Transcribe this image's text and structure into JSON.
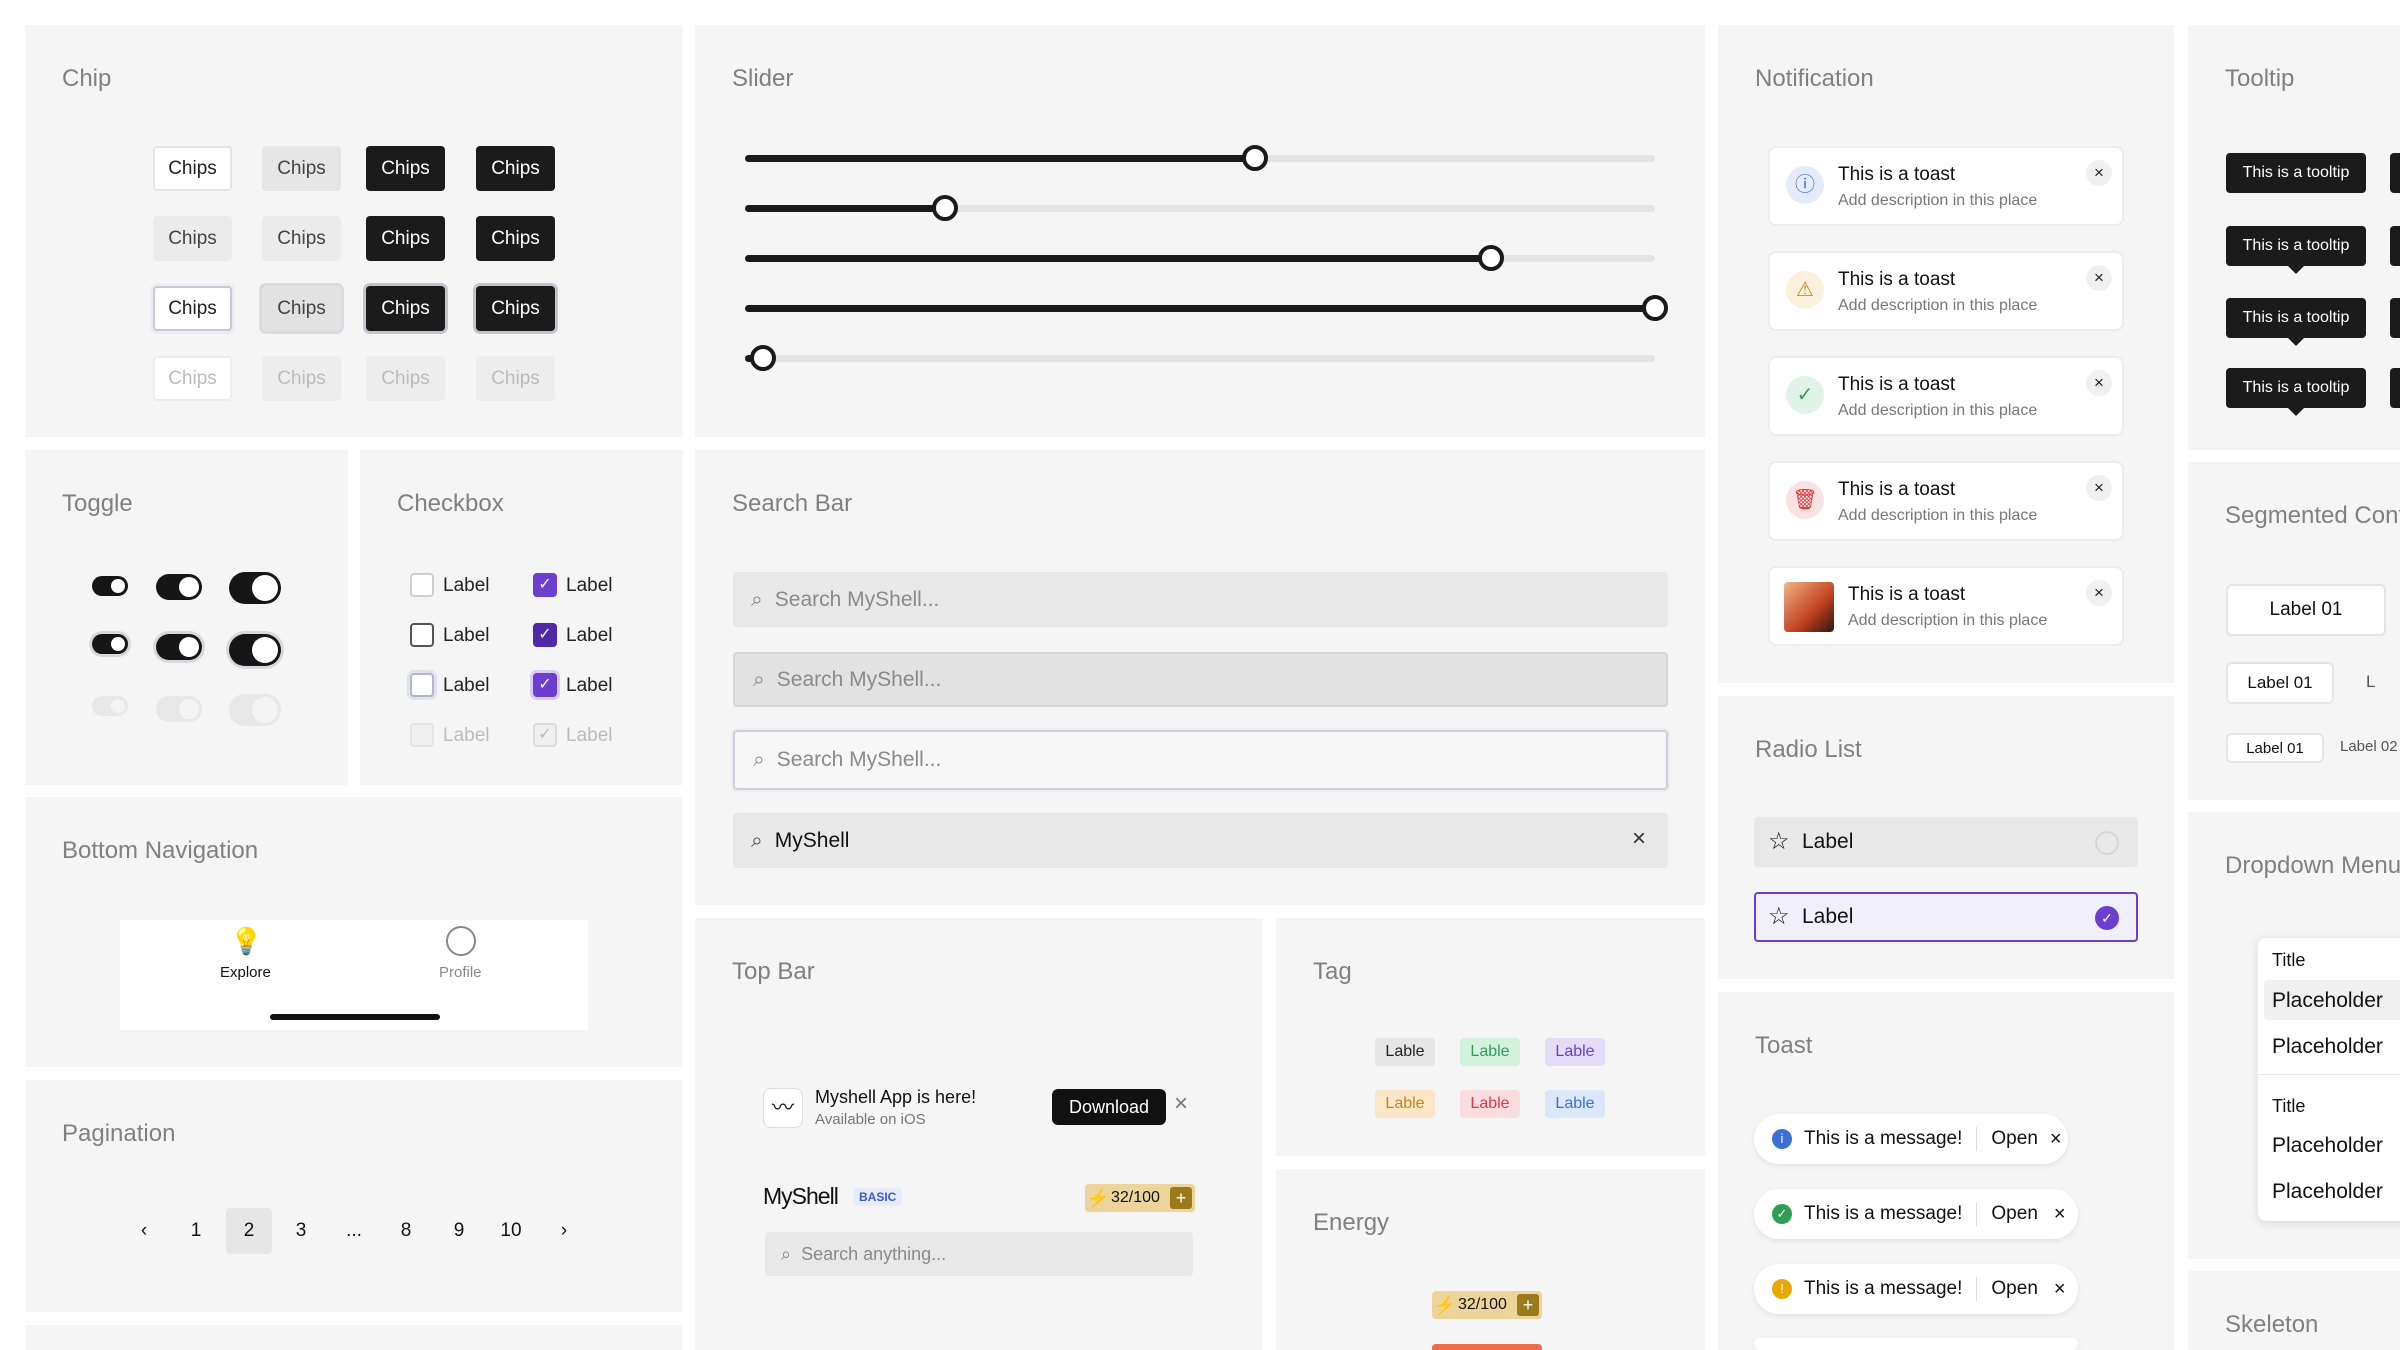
{
  "chip": {
    "title": "Chip",
    "label": "Chips"
  },
  "slider": {
    "title": "Slider",
    "values": [
      0.56,
      0.22,
      0.82,
      1.0,
      0.02
    ]
  },
  "toggle": {
    "title": "Toggle"
  },
  "checkbox": {
    "title": "Checkbox",
    "label": "Label"
  },
  "search": {
    "title": "Search Bar",
    "placeholder": "Search MyShell...",
    "typed": "MyShell"
  },
  "notification": {
    "title": "Notification",
    "toasts": [
      {
        "title": "This is a toast",
        "desc": "Add description in this place"
      },
      {
        "title": "This is a toast",
        "desc": "Add description in this place"
      },
      {
        "title": "This is a toast",
        "desc": "Add description in this place"
      },
      {
        "title": "This is a toast",
        "desc": "Add description in this place"
      },
      {
        "title": "This is a toast",
        "desc": "Add description in this place"
      }
    ]
  },
  "tooltip": {
    "title": "Tooltip",
    "text": "This is a tooltip"
  },
  "segmented": {
    "title": "Segmented Cont",
    "label1": "Label 01",
    "label2": "Label 02"
  },
  "bottom_nav": {
    "title": "Bottom Navigation",
    "explore": "Explore",
    "profile": "Profile"
  },
  "pagination": {
    "title": "Pagination",
    "pages": [
      "1",
      "2",
      "3",
      "...",
      "8",
      "9",
      "10"
    ],
    "current": "2"
  },
  "topbar": {
    "title": "Top Bar",
    "app_title": "Myshell App is here!",
    "app_sub": "Available on iOS",
    "download": "Download",
    "brand": "MyShell",
    "badge": "BASIC",
    "energy": "32/100",
    "search_placeholder": "Search anything..."
  },
  "tag": {
    "title": "Tag",
    "label": "Lable"
  },
  "energy": {
    "title": "Energy",
    "value": "32/100"
  },
  "radio": {
    "title": "Radio List",
    "label": "Label"
  },
  "toast": {
    "title": "Toast",
    "message": "This is a message!",
    "action": "Open"
  },
  "dropdown": {
    "title": "Dropdown Menu",
    "group_title": "Title",
    "item": "Placeholder"
  },
  "skeleton": {
    "title": "Skeleton"
  },
  "colors": {
    "accent": "#6d3fd0",
    "dark": "#1b1b1b",
    "panel": "#f5f5f5"
  }
}
